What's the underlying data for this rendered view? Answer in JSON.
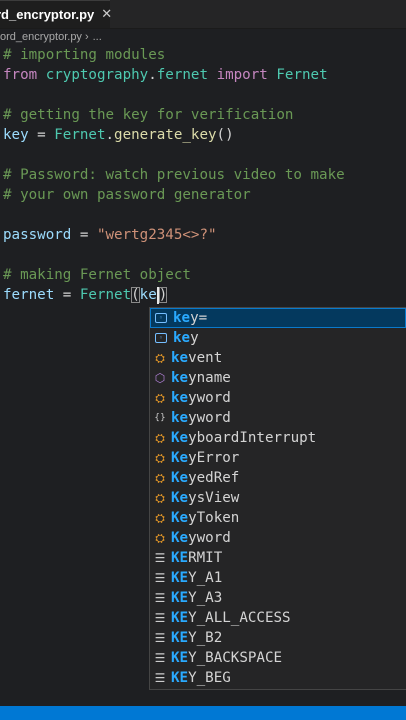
{
  "tab": {
    "label": "rd_encryptor.py",
    "close_glyph": "✕"
  },
  "breadcrumb": {
    "file": "ord_encryptor.py",
    "separator": "›",
    "more": "..."
  },
  "code": {
    "lines": [
      {
        "tokens": [
          {
            "t": "# importing modules",
            "c": "cmt"
          }
        ]
      },
      {
        "tokens": [
          {
            "t": "from",
            "c": "kw"
          },
          {
            "t": " ",
            "c": "op"
          },
          {
            "t": "cryptography",
            "c": "mod"
          },
          {
            "t": ".",
            "c": "op"
          },
          {
            "t": "fernet",
            "c": "mod"
          },
          {
            "t": " ",
            "c": "op"
          },
          {
            "t": "import",
            "c": "kw"
          },
          {
            "t": " ",
            "c": "op"
          },
          {
            "t": "Fernet",
            "c": "cls"
          }
        ]
      },
      {
        "tokens": []
      },
      {
        "tokens": [
          {
            "t": "# getting the key for verification",
            "c": "cmt"
          }
        ]
      },
      {
        "tokens": [
          {
            "t": "key",
            "c": "var"
          },
          {
            "t": " = ",
            "c": "op"
          },
          {
            "t": "Fernet",
            "c": "cls"
          },
          {
            "t": ".",
            "c": "op"
          },
          {
            "t": "generate_key",
            "c": "fn"
          },
          {
            "t": "()",
            "c": "op"
          }
        ]
      },
      {
        "tokens": []
      },
      {
        "tokens": [
          {
            "t": "# Password: watch previous video to make",
            "c": "cmt"
          }
        ]
      },
      {
        "tokens": [
          {
            "t": "# your own password generator",
            "c": "cmt"
          }
        ]
      },
      {
        "tokens": []
      },
      {
        "tokens": [
          {
            "t": "password",
            "c": "var"
          },
          {
            "t": " = ",
            "c": "op"
          },
          {
            "t": "\"wertg2345<>?\"",
            "c": "str"
          }
        ]
      },
      {
        "tokens": []
      },
      {
        "tokens": [
          {
            "t": "# making Fernet object",
            "c": "cmt"
          }
        ]
      },
      {
        "tokens": [
          {
            "t": "fernet",
            "c": "var"
          },
          {
            "t": " = ",
            "c": "op"
          },
          {
            "t": "Fernet",
            "c": "cls"
          },
          {
            "t": "(",
            "c": "op paren-box"
          },
          {
            "t": "ke",
            "c": "var"
          },
          {
            "t": ")",
            "c": "op paren-box"
          }
        ],
        "cursor_after": 4
      }
    ]
  },
  "suggestions": {
    "typed_prefix": "ke",
    "items": [
      {
        "label": "key=",
        "match_len": 2,
        "icon": "variable-icon",
        "icon_glyph": "[◦]",
        "selected": true
      },
      {
        "label": "key",
        "match_len": 2,
        "icon": "variable-icon",
        "icon_glyph": "[◦]"
      },
      {
        "label": "kevent",
        "match_len": 2,
        "icon": "class-icon",
        "icon_glyph": "⛭"
      },
      {
        "label": "keyname",
        "match_len": 2,
        "icon": "module-icon",
        "icon_glyph": "⬡"
      },
      {
        "label": "keyword",
        "match_len": 2,
        "icon": "class-icon",
        "icon_glyph": "⛭"
      },
      {
        "label": "keyword",
        "match_len": 2,
        "icon": "braces-icon",
        "icon_glyph": "{}"
      },
      {
        "label": "KeyboardInterrupt",
        "match_len": 2,
        "icon": "class-icon",
        "icon_glyph": "⛭"
      },
      {
        "label": "KeyError",
        "match_len": 2,
        "icon": "class-icon",
        "icon_glyph": "⛭"
      },
      {
        "label": "KeyedRef",
        "match_len": 2,
        "icon": "class-icon",
        "icon_glyph": "⛭"
      },
      {
        "label": "KeysView",
        "match_len": 2,
        "icon": "class-icon",
        "icon_glyph": "⛭"
      },
      {
        "label": "KeyToken",
        "match_len": 2,
        "icon": "class-icon",
        "icon_glyph": "⛭"
      },
      {
        "label": "Keyword",
        "match_len": 2,
        "icon": "class-icon",
        "icon_glyph": "⛭"
      },
      {
        "label": "KERMIT",
        "match_len": 2,
        "icon": "text-icon",
        "icon_glyph": "☰"
      },
      {
        "label": "KEY_A1",
        "match_len": 2,
        "icon": "text-icon",
        "icon_glyph": "☰"
      },
      {
        "label": "KEY_A3",
        "match_len": 2,
        "icon": "text-icon",
        "icon_glyph": "☰"
      },
      {
        "label": "KEY_ALL_ACCESS",
        "match_len": 2,
        "icon": "text-icon",
        "icon_glyph": "☰"
      },
      {
        "label": "KEY_B2",
        "match_len": 2,
        "icon": "text-icon",
        "icon_glyph": "☰"
      },
      {
        "label": "KEY_BACKSPACE",
        "match_len": 2,
        "icon": "text-icon",
        "icon_glyph": "☰"
      },
      {
        "label": "KEY_BEG",
        "match_len": 2,
        "icon": "text-icon",
        "icon_glyph": "☰"
      }
    ]
  },
  "colors": {
    "editor_bg": "#1e1f22",
    "comment": "#6a9955",
    "keyword": "#c586c0",
    "class": "#4ec9b0",
    "variable": "#9cdcfe",
    "function": "#dcdcaa",
    "string": "#ce9178",
    "match_highlight": "#2aaaff",
    "status_bar": "#0078d4"
  }
}
